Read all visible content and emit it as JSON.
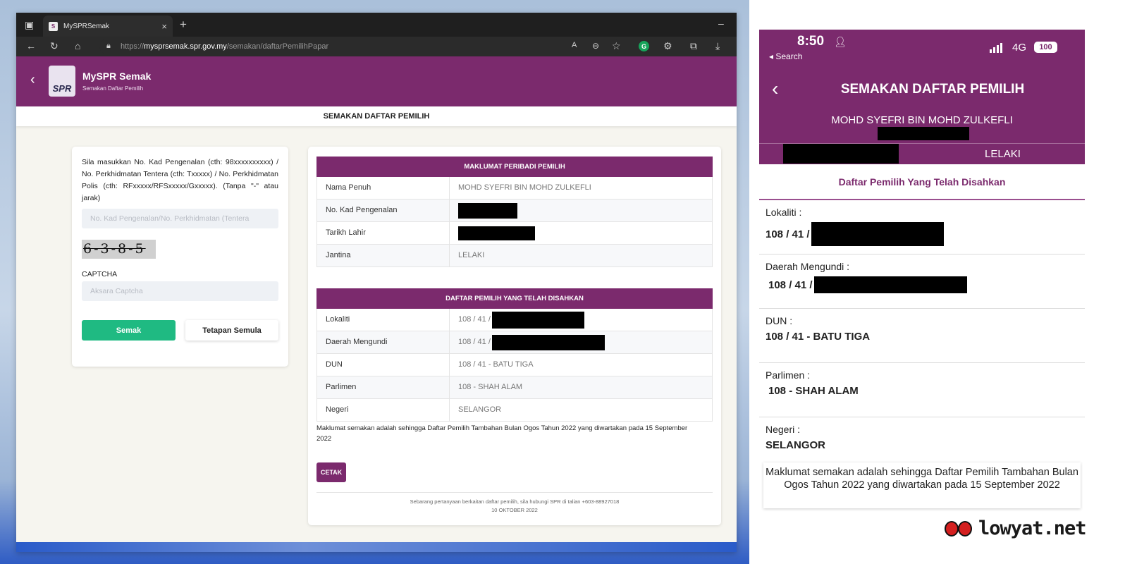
{
  "browser": {
    "tab_title": "MySPRSemak",
    "url_prefix": "https://",
    "url_domain": "mysprsemak.spr.gov.my",
    "url_path": "/semakan/daftarPemilihPapar"
  },
  "site": {
    "title": "MySPR Semak",
    "subtitle": "Semakan Daftar Pemilih",
    "logo_text": "SPR",
    "page_heading": "SEMAKAN DAFTAR PEMILIH"
  },
  "form": {
    "instructions": "Sila masukkan No. Kad Pengenalan (cth: 98xxxxxxxxxx) / No. Perkhidmatan Tentera (cth: Txxxxx) / No. Perkhidmatan Polis (cth: RFxxxxx/RFSxxxxx/Gxxxxx). (Tanpa \"-\" atau jarak)",
    "id_placeholder": "No. Kad Pengenalan/No. Perkhidmatan (Tentera",
    "captcha_image_text": "6-3-8-5",
    "captcha_label": "CAPTCHA",
    "captcha_placeholder": "Aksara Captcha",
    "submit_label": "Semak",
    "reset_label": "Tetapan Semula"
  },
  "personal": {
    "heading": "MAKLUMAT PERIBADI PEMILIH",
    "rows": [
      {
        "key": "Nama Penuh",
        "value": "MOHD SYEFRI BIN MOHD ZULKEFLI"
      },
      {
        "key": "No. Kad Pengenalan",
        "value": ""
      },
      {
        "key": "Tarikh Lahir",
        "value": ""
      },
      {
        "key": "Jantina",
        "value": "LELAKI"
      }
    ]
  },
  "register": {
    "heading": "DAFTAR PEMILIH YANG TELAH DISAHKAN",
    "rows": [
      {
        "key": "Lokaliti",
        "value": "108 / 41 /"
      },
      {
        "key": "Daerah Mengundi",
        "value": "108 / 41 /"
      },
      {
        "key": "DUN",
        "value": "108 / 41 - BATU TIGA"
      },
      {
        "key": "Parlimen",
        "value": "108 - SHAH ALAM"
      },
      {
        "key": "Negeri",
        "value": "SELANGOR"
      }
    ],
    "note": "Maklumat semakan adalah sehingga Daftar Pemilih Tambahan Bulan Ogos Tahun 2022 yang diwartakan pada 15 September 2022",
    "print_label": "CETAK",
    "footer_contact": "Sebarang pertanyaan berkaitan daftar pemilih, sila hubungi SPR di talian +603-88927018",
    "footer_date": "10 OKTOBER 2022"
  },
  "phone": {
    "time": "8:50",
    "back_app": "◂ Search",
    "network": "4G",
    "battery": "100",
    "title": "SEMAKAN DAFTAR PEMILIH",
    "name": "MOHD SYEFRI BIN MOHD ZULKEFLI",
    "gender": "LELAKI",
    "section": "Daftar Pemilih Yang Telah Disahkan",
    "items": [
      {
        "key": "Lokaliti :",
        "value": "108 / 41 /"
      },
      {
        "key": "Daerah Mengundi :",
        "value": "108 / 41 /"
      },
      {
        "key": "DUN :",
        "value": "108 / 41 - BATU TIGA"
      },
      {
        "key": "Parlimen :",
        "value": "108 - SHAH ALAM"
      },
      {
        "key": "Negeri :",
        "value": "SELANGOR"
      }
    ],
    "note": "Maklumat semakan adalah sehingga Daftar Pemilih Tambahan Bulan Ogos Tahun 2022 yang diwartakan pada 15 September 2022"
  },
  "watermark": "lowyat.net",
  "colors": {
    "brand_purple": "#7b2a6d",
    "semak_green": "#1fba82"
  }
}
